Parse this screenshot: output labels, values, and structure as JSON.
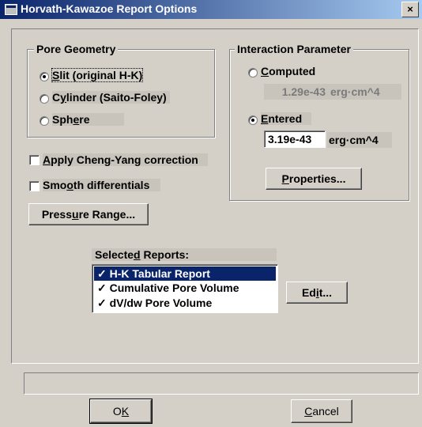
{
  "window": {
    "title": "Horvath-Kawazoe Report Options",
    "close_glyph": "×"
  },
  "pore_geometry": {
    "title": "Pore Geometry",
    "options": [
      {
        "pre": "",
        "key": "S",
        "post": "lit (original H-K)",
        "selected": true
      },
      {
        "pre": "C",
        "key": "y",
        "post": "linder (Saito-Foley)",
        "selected": false
      },
      {
        "pre": "Sph",
        "key": "e",
        "post": "re",
        "selected": false
      }
    ]
  },
  "interaction_parameter": {
    "title": "Interaction Parameter",
    "computed": {
      "pre": "",
      "key": "C",
      "post": "omputed",
      "selected": false,
      "value": "1.29e-43",
      "unit": "erg·cm^4"
    },
    "entered": {
      "pre": "",
      "key": "E",
      "post": "ntered",
      "selected": true,
      "value": "3.19e-43",
      "unit": "erg·cm^4"
    },
    "properties_button": {
      "pre": "",
      "key": "P",
      "post": "roperties..."
    }
  },
  "options": {
    "cheng_yang": {
      "pre": "",
      "key": "A",
      "post": "pply Cheng-Yang correction",
      "checked": false
    },
    "smooth": {
      "pre": "Smo",
      "key": "o",
      "post": "th differentials",
      "checked": false
    }
  },
  "pressure_range_button": {
    "pre": "Press",
    "key": "u",
    "post": "re Range..."
  },
  "selected_reports": {
    "label_pre": "Selecte",
    "label_key": "d",
    "label_post": " Reports:",
    "items": [
      {
        "check": "✓",
        "label": "H-K Tabular Report",
        "selected": true
      },
      {
        "check": "✓",
        "label": "Cumulative Pore Volume",
        "selected": false
      },
      {
        "check": "✓",
        "label": "dV/dw Pore Volume",
        "selected": false
      }
    ]
  },
  "edit_button": {
    "pre": "Ed",
    "key": "i",
    "post": "t..."
  },
  "ok_button": {
    "pre": "O",
    "key": "K",
    "post": ""
  },
  "cancel_button": {
    "pre": "",
    "key": "C",
    "post": "ancel"
  }
}
